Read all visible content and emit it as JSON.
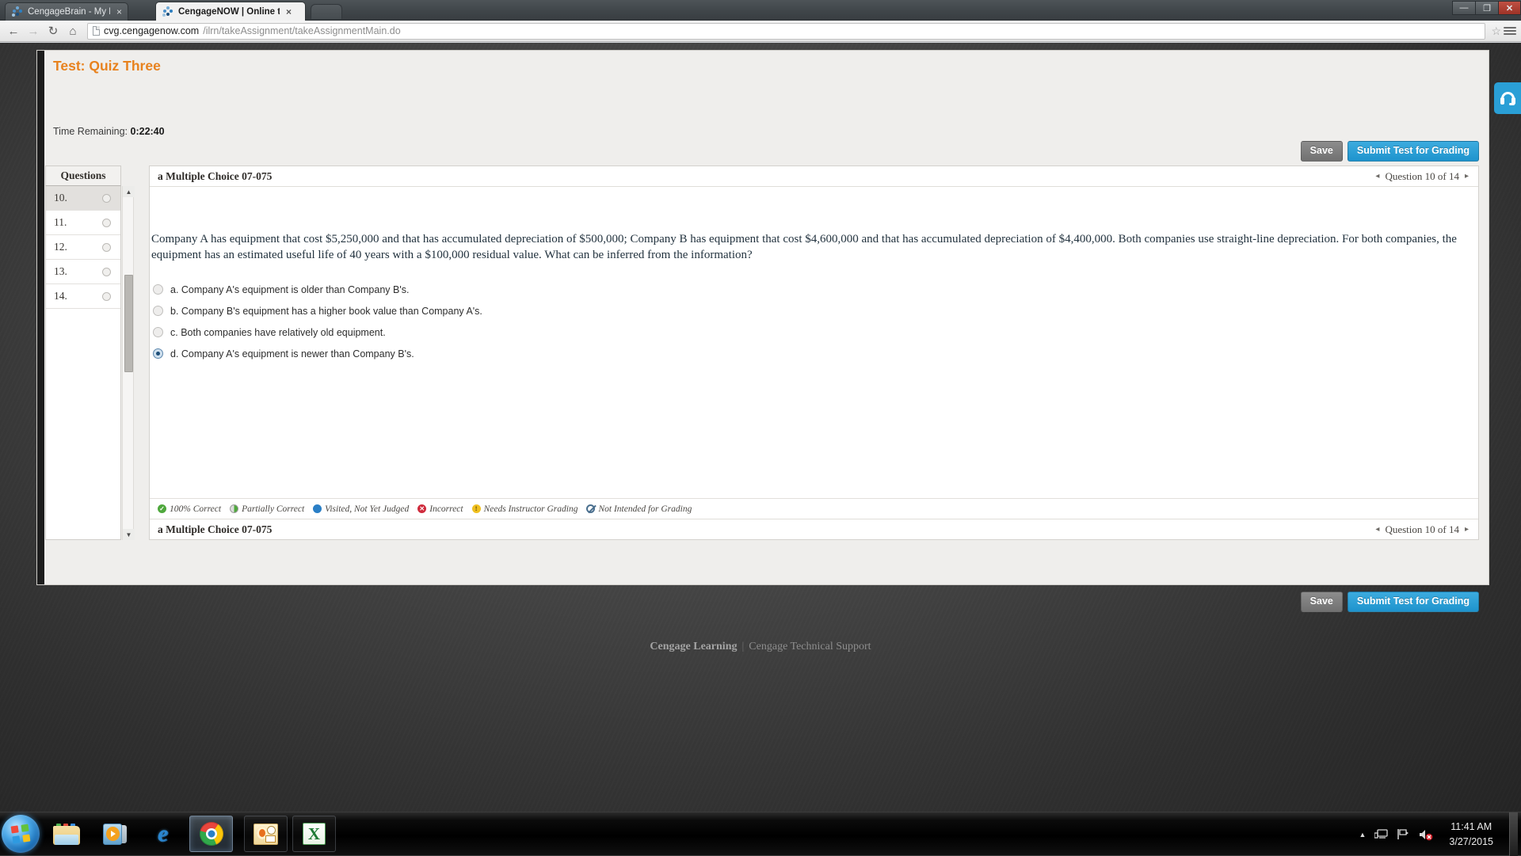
{
  "browser": {
    "tabs": [
      {
        "title": "CengageBrain - My Home",
        "active": false,
        "favicon": "cengage-icon",
        "close": "×"
      },
      {
        "title": "CengageNOW | Online tea",
        "active": true,
        "favicon": "cengage-icon",
        "close": "×"
      }
    ],
    "window_controls": {
      "minimize": "—",
      "maximize": "❐",
      "close": "✕"
    },
    "nav": {
      "back": "←",
      "forward": "→",
      "reload": "↻",
      "home": "⌂"
    },
    "url": {
      "host": "cvg.cengagenow.com",
      "path": "/ilrn/takeAssignment/takeAssignmentMain.do"
    },
    "bookmark_star": "☆"
  },
  "test": {
    "title": "Test: Quiz Three",
    "time_label": "Time Remaining:",
    "time_value": "0:22:40",
    "save_label": "Save",
    "submit_label": "Submit Test for Grading"
  },
  "sidebar": {
    "header": "Questions",
    "items": [
      {
        "number": "10.",
        "current": true
      },
      {
        "number": "11.",
        "current": false
      },
      {
        "number": "12.",
        "current": false
      },
      {
        "number": "13.",
        "current": false
      },
      {
        "number": "14.",
        "current": false
      }
    ],
    "scroll_up": "▲",
    "scroll_down": "▼"
  },
  "question": {
    "label": "a Multiple Choice 07-075",
    "nav_prev": "◂",
    "nav_text": "Question 10 of 14",
    "nav_next": "▸",
    "text": "Company A has equipment that cost $5,250,000 and that has accumulated depreciation of $500,000; Company B has equipment that cost $4,600,000 and that has accumulated depreciation of $4,400,000. Both companies use straight-line depreciation. For both companies, the equipment has an estimated useful life of 40 years with a $100,000 residual value. What can be inferred from the information?",
    "choices": [
      {
        "text": "a. Company A's equipment is older than Company B's.",
        "selected": false
      },
      {
        "text": "b. Company B's equipment has a higher book value than Company A's.",
        "selected": false
      },
      {
        "text": "c. Both companies have relatively old equipment.",
        "selected": false
      },
      {
        "text": "d. Company A's equipment is newer than Company B's.",
        "selected": true
      }
    ]
  },
  "legend": [
    {
      "label": "100% Correct",
      "icon": "check-circle-icon",
      "glyph": "✓",
      "color": "#4fa83d",
      "style": "lg-correct"
    },
    {
      "label": "Partially Correct",
      "icon": "half-circle-icon",
      "glyph": "",
      "color": "#4fa83d",
      "style": "lg-partial"
    },
    {
      "label": "Visited, Not Yet Judged",
      "icon": "filled-circle-icon",
      "glyph": "",
      "color": "#2a7fc6",
      "style": "lg-visited"
    },
    {
      "label": "Incorrect",
      "icon": "x-circle-icon",
      "glyph": "✕",
      "color": "#cf2b3c",
      "style": "lg-incorrect"
    },
    {
      "label": "Needs Instructor Grading",
      "icon": "exclamation-circle-icon",
      "glyph": "!",
      "color": "#f0c020",
      "style": "lg-needs"
    },
    {
      "label": "Not Intended for Grading",
      "icon": "no-entry-icon",
      "glyph": "",
      "color": "#4a6f8e",
      "style": "lg-none"
    }
  ],
  "support": {
    "icon": "headset-icon"
  },
  "page_footer": {
    "brand": "Cengage Learning",
    "separator": "|",
    "support_link": "Cengage Technical Support"
  },
  "taskbar": {
    "start": "start-orb-icon",
    "buttons": [
      {
        "name": "file-explorer",
        "active": false
      },
      {
        "name": "windows-media-player",
        "active": false
      },
      {
        "name": "internet-explorer",
        "active": false,
        "glyph": "e"
      },
      {
        "name": "google-chrome",
        "active": true
      },
      {
        "name": "microsoft-outlook",
        "active": false
      },
      {
        "name": "microsoft-excel",
        "active": false,
        "glyph": "X"
      }
    ],
    "tray": {
      "show_hidden": "▲",
      "network_icon": "network-icon",
      "flag_icon": "action-center-flag-icon",
      "volume_icon": "volume-muted-icon",
      "time": "11:41 AM",
      "date": "3/27/2015"
    }
  }
}
